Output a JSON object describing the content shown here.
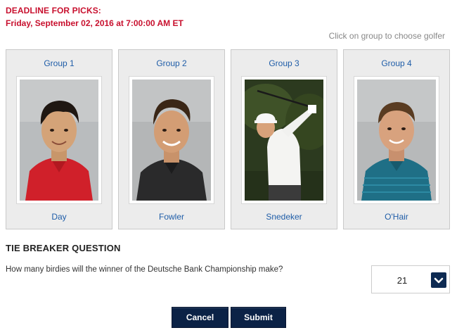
{
  "deadline": {
    "title": "DEADLINE FOR PICKS:",
    "date": "Friday, September 02, 2016 at 7:00:00 AM ET"
  },
  "instruction": "Click on group to choose golfer",
  "groups": [
    {
      "label": "Group 1",
      "golfer": "Day"
    },
    {
      "label": "Group 2",
      "golfer": "Fowler"
    },
    {
      "label": "Group 3",
      "golfer": "Snedeker"
    },
    {
      "label": "Group 4",
      "golfer": "O'Hair"
    }
  ],
  "tiebreaker": {
    "heading": "TIE BREAKER QUESTION",
    "question": "How many birdies will the winner of the Deutsche Bank Championship make?",
    "selected_value": "21"
  },
  "buttons": {
    "cancel": "Cancel",
    "submit": "Submit"
  },
  "colors": {
    "deadline_red": "#c8102e",
    "link_blue": "#1f5da8",
    "button_navy": "#0b2246"
  }
}
